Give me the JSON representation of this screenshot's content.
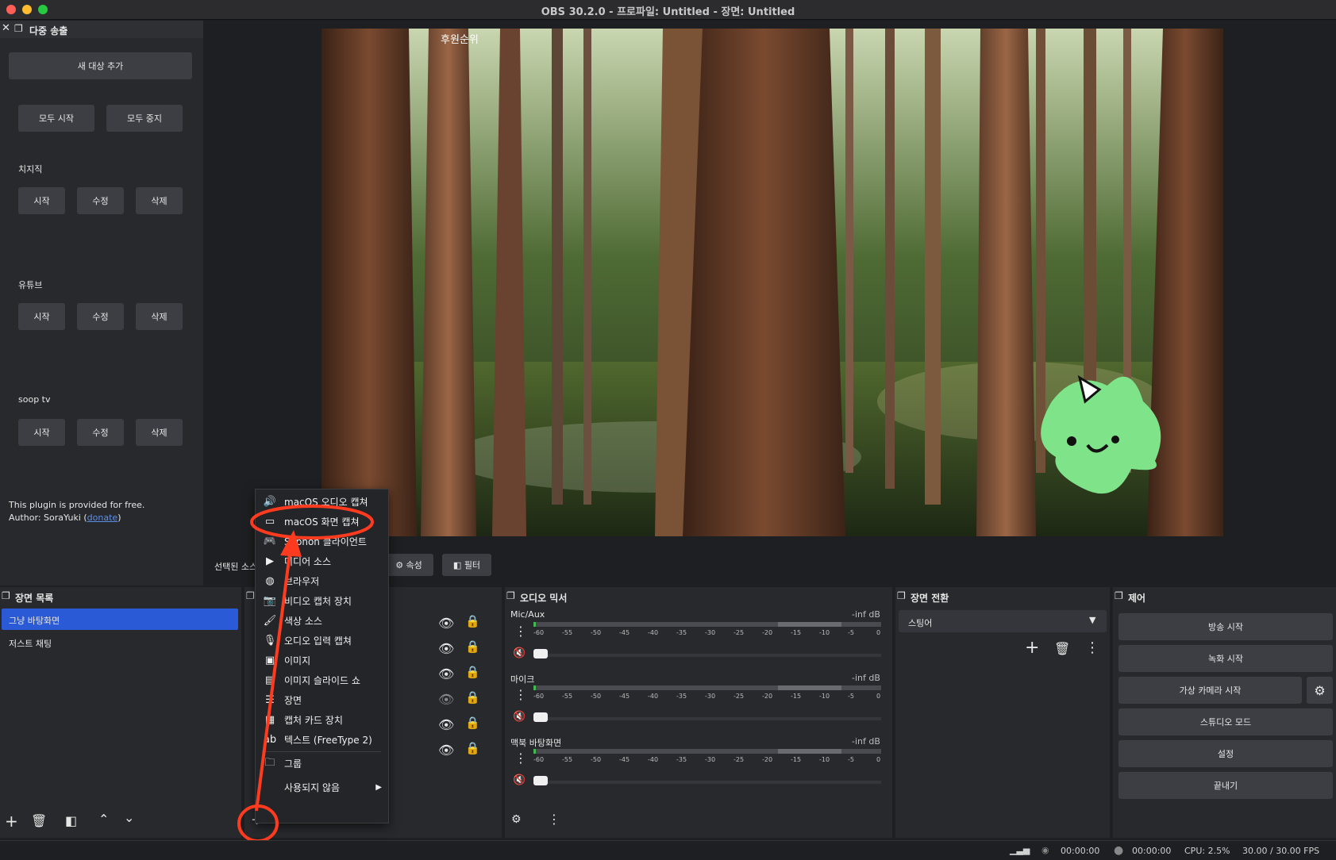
{
  "window": {
    "title": "OBS 30.2.0 - 프로파일: Untitled - 장면: Untitled"
  },
  "multistream": {
    "title": "다중 송출",
    "add_target": "새 대상 추가",
    "start_all": "모두 시작",
    "stop_all": "모두 중지",
    "targets": [
      {
        "name": "치지직",
        "start": "시작",
        "edit": "수정",
        "delete": "삭제"
      },
      {
        "name": "유튜브",
        "start": "시작",
        "edit": "수정",
        "delete": "삭제"
      },
      {
        "name": "soop tv",
        "start": "시작",
        "edit": "수정",
        "delete": "삭제"
      }
    ],
    "footer_line1": "This plugin is provided for free.",
    "footer_author": "Author: SoraYuki (",
    "footer_donate": "donate",
    "footer_close": ")"
  },
  "preview": {
    "overlay_text": "후원순위"
  },
  "source_toolbar": {
    "selected_label": "선택된 소스",
    "properties": "속성",
    "filters": "필터"
  },
  "scenes": {
    "title": "장면 목록",
    "items": [
      "그냥 바탕화면",
      "저스트 채팅"
    ]
  },
  "add_source_menu": {
    "items": [
      {
        "icon": "speaker-icon",
        "label": "macOS 오디오 캡쳐"
      },
      {
        "icon": "monitor-icon",
        "label": "macOS 화면 캡쳐"
      },
      {
        "icon": "gamepad-icon",
        "label": "Syphon 클라이언트"
      },
      {
        "icon": "play-icon",
        "label": "미디어 소스"
      },
      {
        "icon": "globe-icon",
        "label": "브라우저"
      },
      {
        "icon": "camera-icon",
        "label": "비디오 캡처 장치"
      },
      {
        "icon": "brush-icon",
        "label": "색상 소스"
      },
      {
        "icon": "mic-icon",
        "label": "오디오 입력 캡쳐"
      },
      {
        "icon": "image-icon",
        "label": "이미지"
      },
      {
        "icon": "slideshow-icon",
        "label": "이미지 슬라이드 쇼"
      },
      {
        "icon": "list-icon",
        "label": "장면"
      },
      {
        "icon": "capture-card-icon",
        "label": "캡처 카드 장치"
      },
      {
        "icon": "text-icon",
        "label": "텍스트 (FreeType 2)"
      },
      {
        "icon": "folder-icon",
        "label": "그룹"
      },
      {
        "icon": "submenu-icon",
        "label": "사용되지 않음"
      }
    ]
  },
  "audio_mixer": {
    "title": "오디오 믹서",
    "ticks": [
      "-60",
      "-55",
      "-50",
      "-45",
      "-40",
      "-35",
      "-30",
      "-25",
      "-20",
      "-15",
      "-10",
      "-5",
      "0"
    ],
    "channels": [
      {
        "name": "Mic/Aux",
        "level": "-inf dB"
      },
      {
        "name": "마이크",
        "level": "-inf dB"
      },
      {
        "name": "맥북 바탕화면",
        "level": "-inf dB"
      }
    ]
  },
  "transitions": {
    "title": "장면 전환",
    "selected": "스팅어"
  },
  "controls": {
    "title": "제어",
    "start_stream": "방송 시작",
    "start_record": "녹화 시작",
    "virtual_cam": "가상 카메라 시작",
    "studio_mode": "스튜디오 모드",
    "settings": "설정",
    "exit": "끝내기"
  },
  "status_bar": {
    "stream_time": "00:00:00",
    "rec_time": "00:00:00",
    "cpu": "CPU: 2.5%",
    "fps": "30.00 / 30.00 FPS"
  },
  "colors": {
    "accent": "#2b5ad6",
    "annotation": "#ff3b1f"
  }
}
